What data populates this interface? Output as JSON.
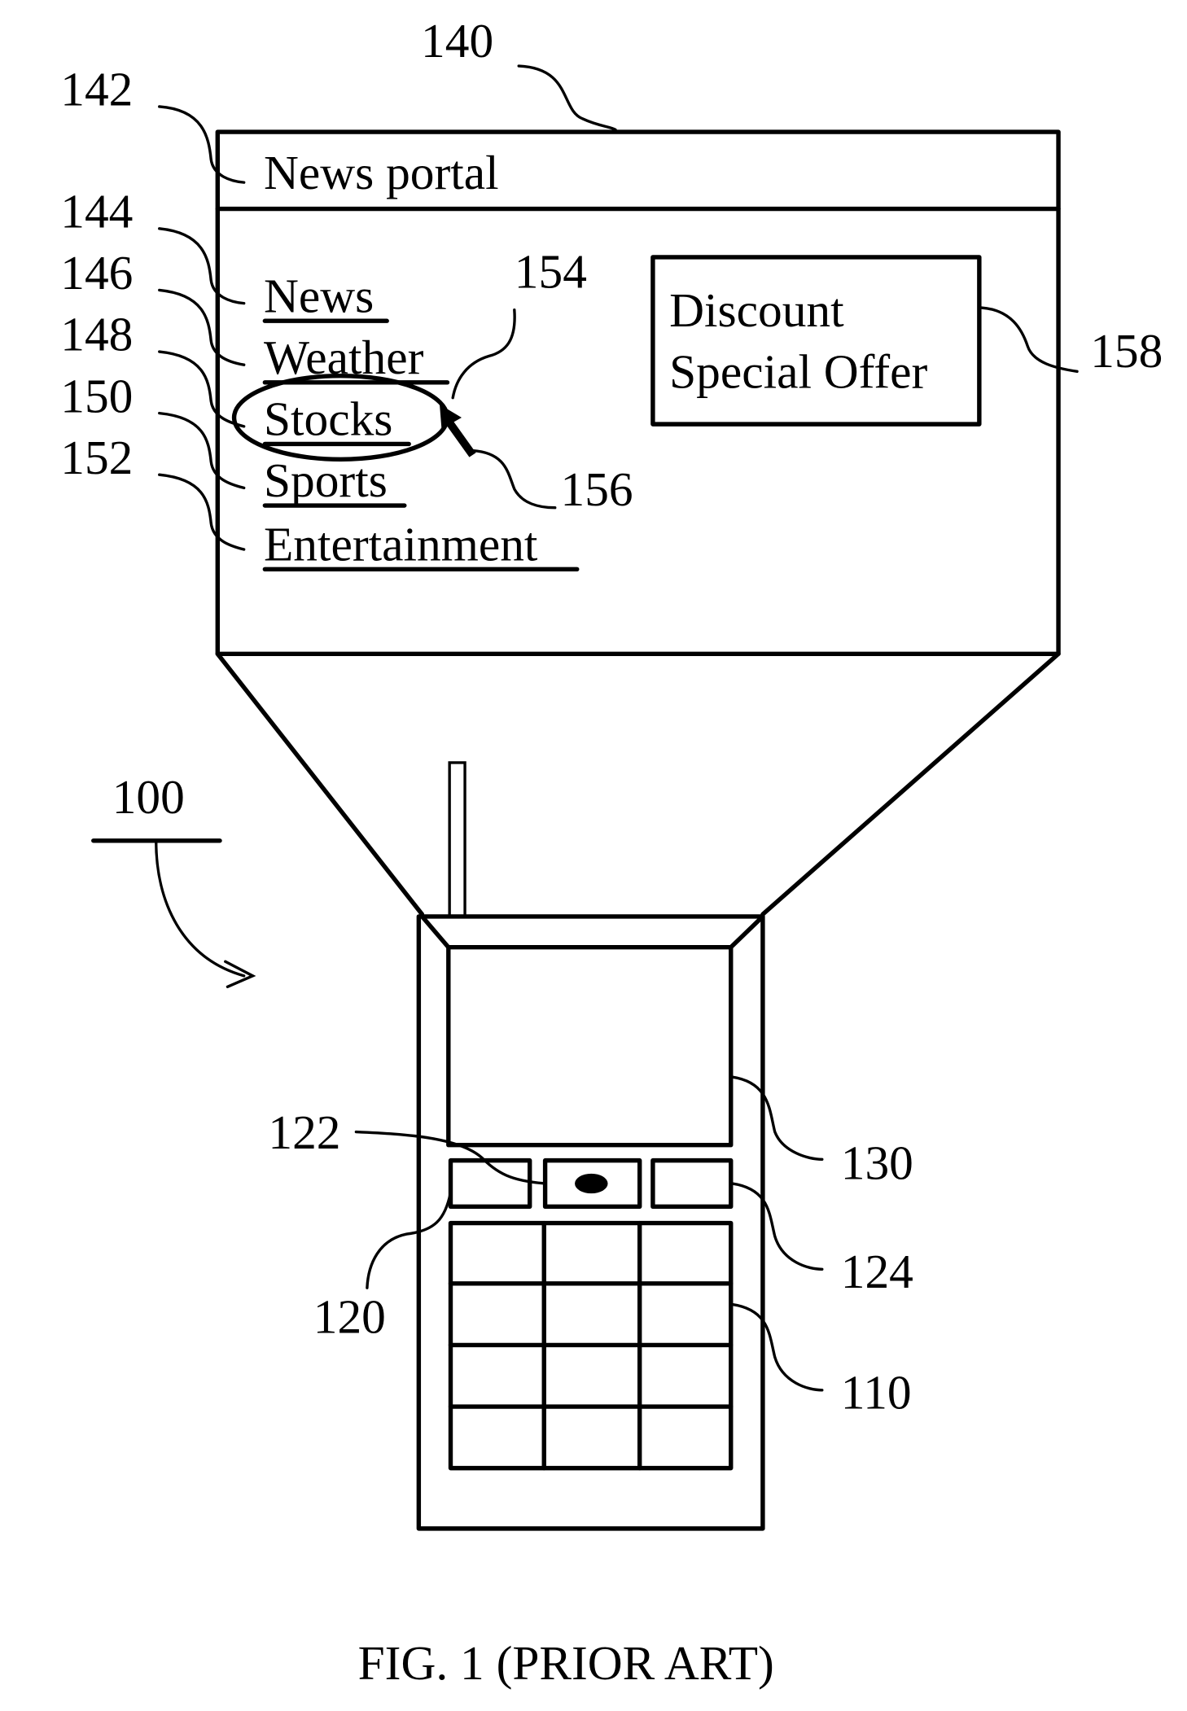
{
  "figure": {
    "caption": "FIG. 1 (PRIOR ART)"
  },
  "portal": {
    "title": "News portal",
    "links": [
      "News",
      "Weather",
      "Stocks",
      "Sports",
      "Entertainment"
    ],
    "selected_link": "Stocks",
    "ad": {
      "line1": "Discount",
      "line2": "Special Offer"
    }
  },
  "reference_numerals": {
    "device": "100",
    "keypad": "110",
    "nav_keys": "120",
    "center_key": "122",
    "right_key": "124",
    "display": "130",
    "browser_screen": "140",
    "title_bar": "142",
    "link_news": "144",
    "link_weather": "146",
    "link_stocks": "148",
    "link_sports": "150",
    "link_entertainment": "152",
    "selection_highlight": "154",
    "cursor": "156",
    "advertisement": "158"
  },
  "icons": {
    "cursor": "arrow-pointer-icon",
    "center_key": "dot-icon"
  }
}
